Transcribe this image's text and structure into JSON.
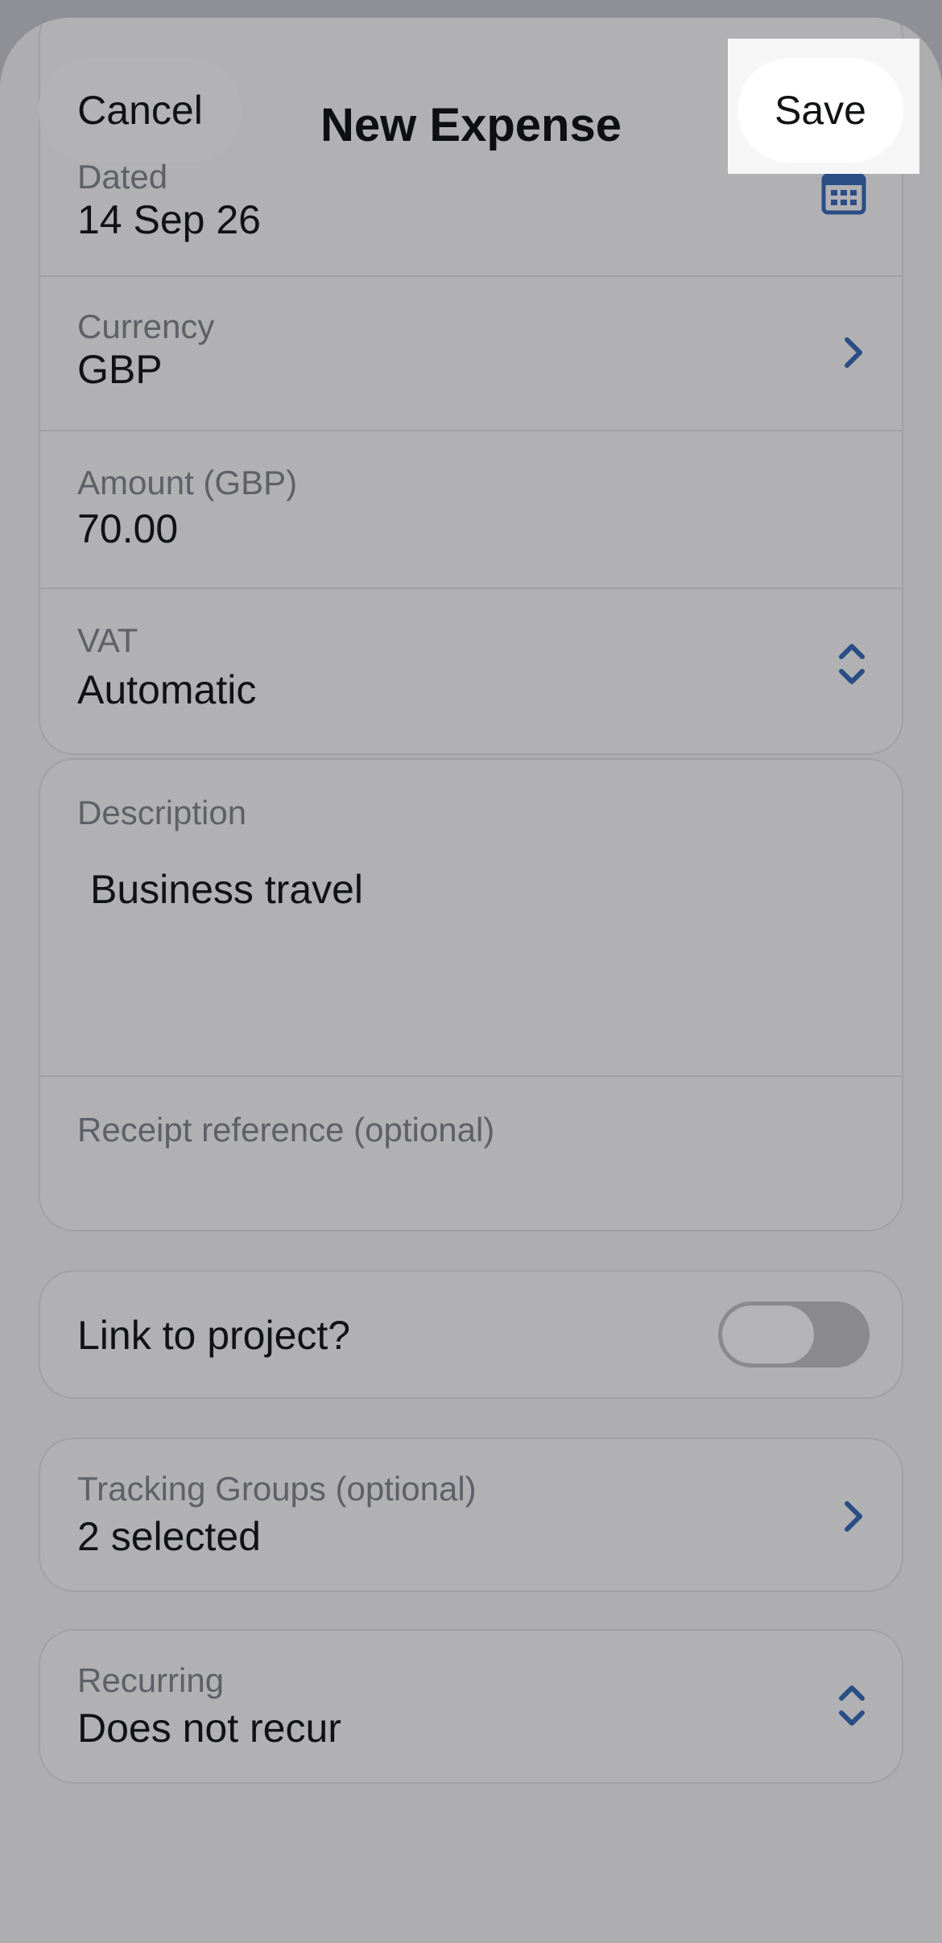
{
  "header": {
    "title": "New Expense",
    "cancel_label": "Cancel",
    "save_label": "Save"
  },
  "details": {
    "dated": {
      "label": "Dated",
      "value": "14 Sep 26"
    },
    "currency": {
      "label": "Currency",
      "value": "GBP"
    },
    "amount": {
      "label": "Amount (GBP)",
      "value": "70.00"
    },
    "vat": {
      "label": "VAT",
      "value": "Automatic"
    }
  },
  "description": {
    "label": "Description",
    "value": "Business travel",
    "receipt_label": "Receipt reference (optional)"
  },
  "project": {
    "label": "Link to project?",
    "enabled": false
  },
  "tracking": {
    "label": "Tracking Groups (optional)",
    "value": "2 selected"
  },
  "recurring": {
    "label": "Recurring",
    "value": "Does not recur"
  },
  "colors": {
    "accent_icon": "#2a4d86",
    "sheet_background": "#aeaeb1"
  }
}
